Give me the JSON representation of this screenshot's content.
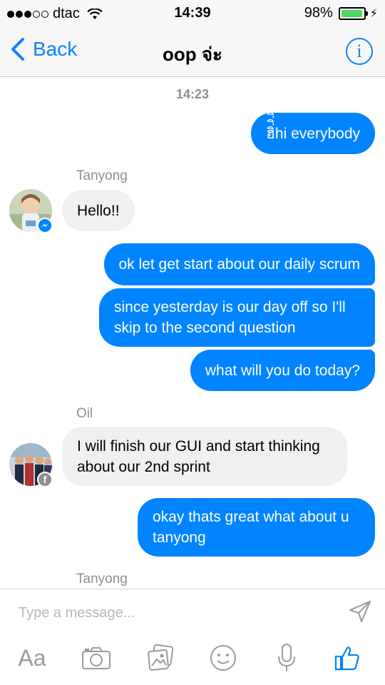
{
  "status_bar": {
    "carrier": "dtac",
    "time": "14:39",
    "battery_percent": "98%",
    "battery_level": 0.98
  },
  "nav": {
    "back_label": "Back",
    "title": "oop จ่ะ",
    "info_label": "i"
  },
  "chat": {
    "timestamp": "14:23",
    "messages": [
      {
        "direction": "out",
        "text": "ฮิ่ิ่ิ่ิ่ิ่hi everybody"
      },
      {
        "direction": "in",
        "sender": "Tanyong",
        "text": "Hello!!"
      },
      {
        "direction": "out",
        "text": "ok let get start about our daily scrum"
      },
      {
        "direction": "out",
        "text": "since yesterday is our day off so I'll skip to the second question"
      },
      {
        "direction": "out",
        "text": "what will you do today?"
      },
      {
        "direction": "in",
        "sender": "Oil",
        "text": "I will finish our GUI and start thinking about our 2nd sprint"
      },
      {
        "direction": "out",
        "text": "okay thats great what about u tanyong"
      }
    ],
    "pending_sender": "Tanyong"
  },
  "composer": {
    "placeholder": "Type a message...",
    "value": "",
    "text_format_label": "Aa"
  },
  "colors": {
    "accent": "#0084ff",
    "ios_blue": "#0a84ff",
    "incoming_bubble": "#f0f0f0",
    "battery_green": "#4cd964",
    "messenger_badge": "#0084ff",
    "facebook_badge": "#8e8e93"
  },
  "icons": {
    "back": "chevron-left-icon",
    "info": "info-circle-icon",
    "send": "paper-plane-icon",
    "camera": "camera-icon",
    "gallery": "photo-gallery-icon",
    "sticker": "smiley-icon",
    "microphone": "microphone-icon",
    "like": "thumbs-up-icon"
  }
}
